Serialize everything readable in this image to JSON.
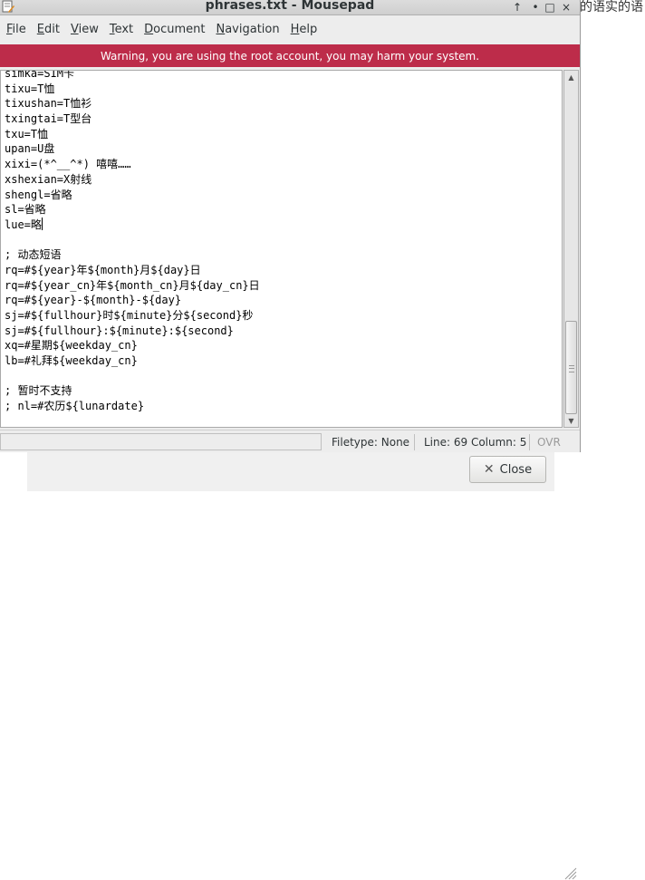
{
  "window": {
    "title": "phrases.txt - Mousepad",
    "controls": [
      "↑",
      "•",
      "□",
      "×"
    ]
  },
  "menu": {
    "file": {
      "accel": "F",
      "rest": "ile"
    },
    "edit": {
      "accel": "E",
      "rest": "dit"
    },
    "view": {
      "accel": "V",
      "rest": "iew"
    },
    "text": {
      "accel": "T",
      "rest": "ext"
    },
    "document": {
      "accel": "D",
      "rest": "ocument"
    },
    "navigation": {
      "accel": "N",
      "rest": "avigation"
    },
    "help": {
      "accel": "H",
      "rest": "elp"
    }
  },
  "warning": "Warning, you are using the root account, you may harm your system.",
  "editor": {
    "lines": [
      "simka=SIM卡",
      "tixu=T恤",
      "tixushan=T恤衫",
      "txingtai=T型台",
      "txu=T恤",
      "upan=U盘",
      "xixi=(*^__^*) 嘻嘻……",
      "xshexian=X射线",
      "shengl=省略",
      "sl=省略",
      "lue=略",
      "",
      "; 动态短语",
      "rq=#${year}年${month}月${day}日",
      "rq=#${year_cn}年${month_cn}月${day_cn}日",
      "rq=#${year}-${month}-${day}",
      "sj=#${fullhour}时${minute}分${second}秒",
      "sj=#${fullhour}:${minute}:${second}",
      "xq=#星期${weekday_cn}",
      "lb=#礼拜${weekday_cn}",
      "",
      "; 暂时不支持",
      "; nl=#农历${lunardate}"
    ],
    "cursor_line_index": 10
  },
  "status": {
    "filetype": "Filetype: None",
    "position": "Line: 69 Column: 5",
    "mode": "OVR"
  },
  "background": {
    "partial_text": "的语实的语",
    "close_button_label": "Close"
  },
  "colors": {
    "warning_bg": "#bd2c4a",
    "window_bg": "#ededed"
  }
}
